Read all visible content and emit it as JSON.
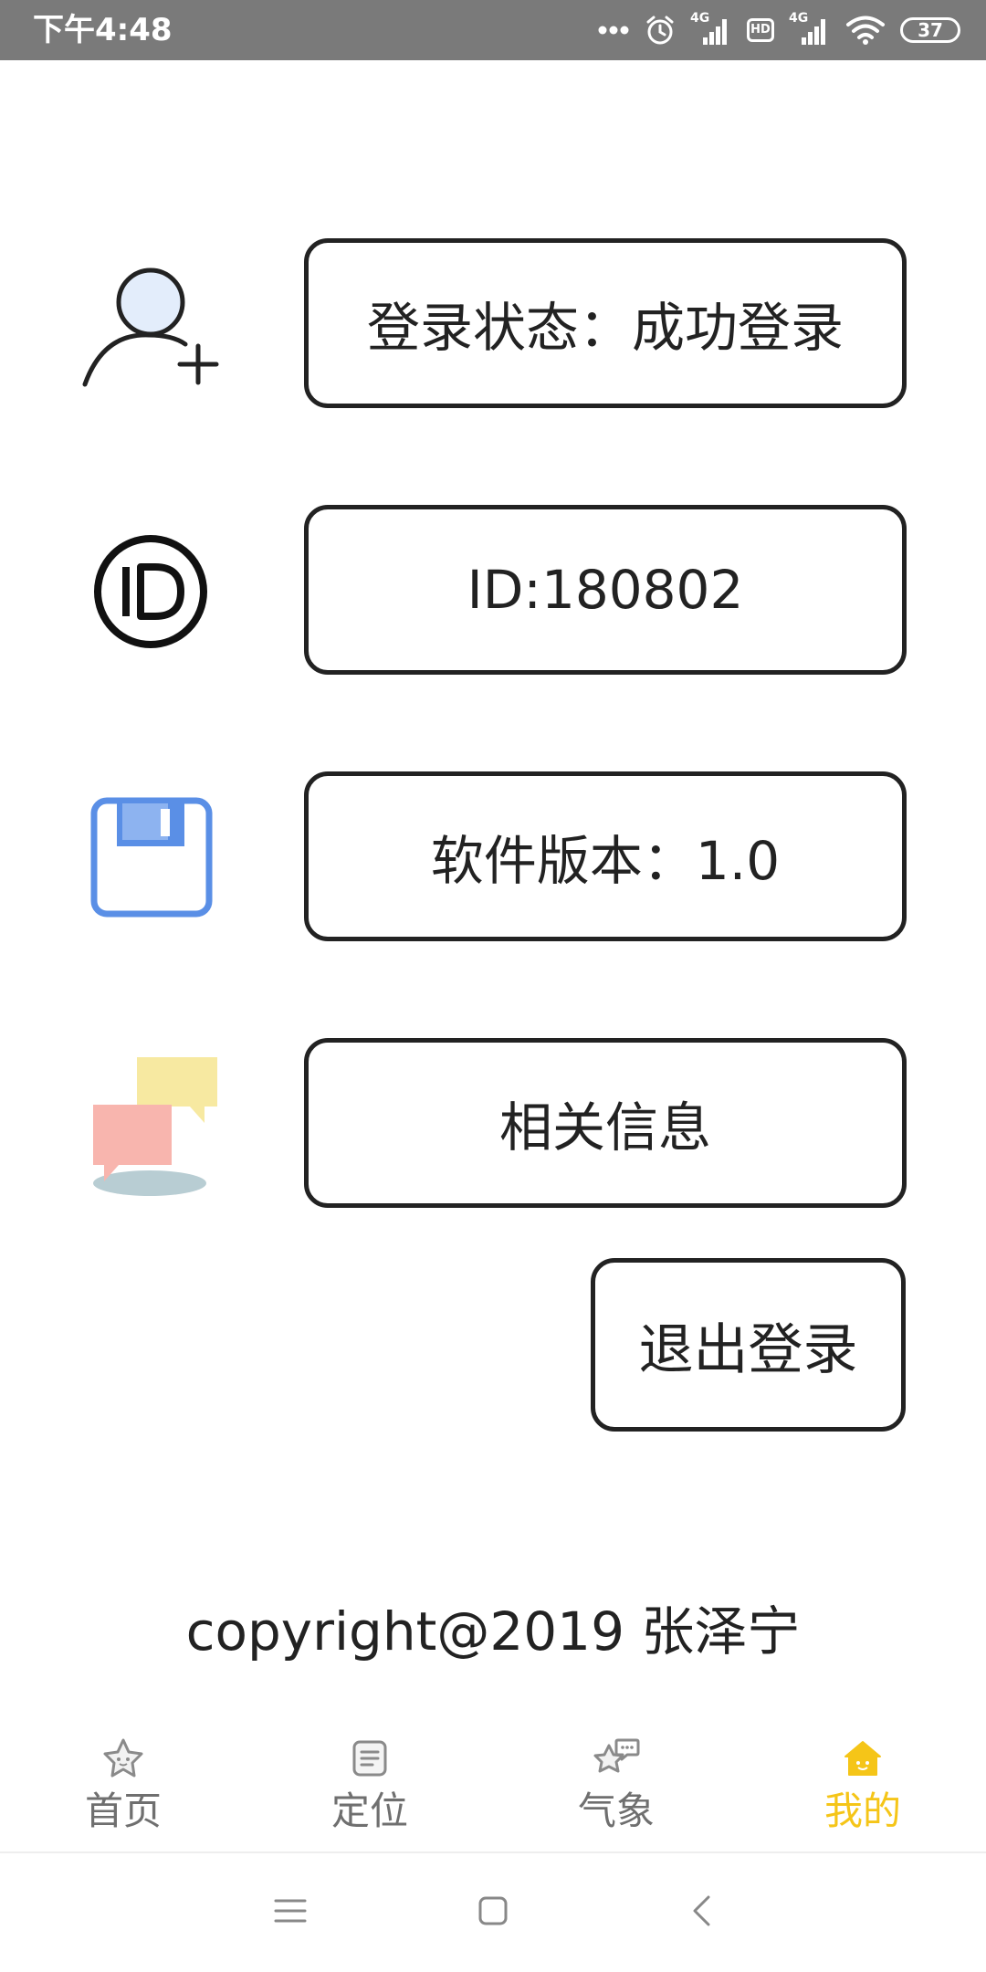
{
  "status_bar": {
    "time": "下午4:48",
    "network_1": "4G",
    "network_2": "4G",
    "hd_badge": "HD",
    "battery": "37"
  },
  "rows": {
    "login_status": "登录状态：成功登录",
    "user_id": "ID:180802",
    "version": "软件版本：1.0",
    "about": "相关信息"
  },
  "logout_label": "退出登录",
  "copyright": "copyright@2019 张泽宁",
  "tabs": [
    {
      "label": "首页",
      "icon": "star-face-icon",
      "active": false
    },
    {
      "label": "定位",
      "icon": "document-icon",
      "active": false
    },
    {
      "label": "气象",
      "icon": "chat-star-icon",
      "active": false
    },
    {
      "label": "我的",
      "icon": "home-icon",
      "active": true
    }
  ],
  "colors": {
    "accent": "#f5c518",
    "status_bar_bg": "#7a7a7a",
    "border": "#222222",
    "tab_inactive": "#6f6f6f",
    "floppy_blue": "#5a8fe6"
  },
  "nav": {
    "icons": [
      "menu-icon",
      "home-square-icon",
      "back-icon"
    ]
  }
}
